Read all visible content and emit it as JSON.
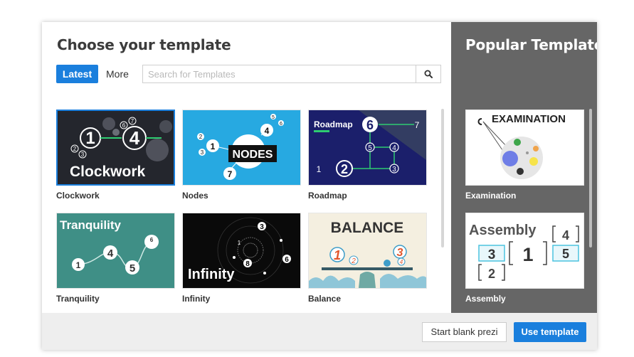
{
  "dialog": {
    "title": "Choose your template",
    "tabs": {
      "latest": "Latest",
      "more": "More"
    },
    "search": {
      "placeholder": "Search for Templates",
      "value": ""
    },
    "templates": [
      {
        "label": "Clockwork",
        "thumb_text": "Clockwork",
        "numbers": [
          "1",
          "4",
          "2",
          "3",
          "6",
          "7"
        ]
      },
      {
        "label": "Nodes",
        "thumb_text": "NODES",
        "numbers": [
          "1",
          "2",
          "3",
          "4",
          "5",
          "6",
          "7"
        ]
      },
      {
        "label": "Roadmap",
        "thumb_text": "Roadmap",
        "numbers": [
          "6",
          "7",
          "5",
          "4",
          "1",
          "2",
          "3"
        ]
      },
      {
        "label": "Tranquility",
        "thumb_text": "Tranquility",
        "numbers": [
          "6",
          "4",
          "5",
          "1"
        ]
      },
      {
        "label": "Infinity",
        "thumb_text": "Infinity",
        "numbers": [
          "3",
          "1",
          "8",
          "6"
        ]
      },
      {
        "label": "Balance",
        "thumb_text": "BALANCE",
        "numbers": [
          "1",
          "2",
          "3",
          "4"
        ]
      }
    ]
  },
  "sidebar": {
    "title": "Popular Templates",
    "templates": [
      {
        "label": "Examination",
        "thumb_text": "EXAMINATION"
      },
      {
        "label": "Assembly",
        "thumb_text": "Assembly",
        "numbers": [
          "4",
          "3",
          "1",
          "5",
          "2"
        ]
      }
    ]
  },
  "footer": {
    "blank_label": "Start blank prezi",
    "use_label": "Use template"
  },
  "colors": {
    "accent": "#1a7fdd",
    "sidebar_bg": "#666666",
    "footer_bg": "#eeeeee"
  }
}
